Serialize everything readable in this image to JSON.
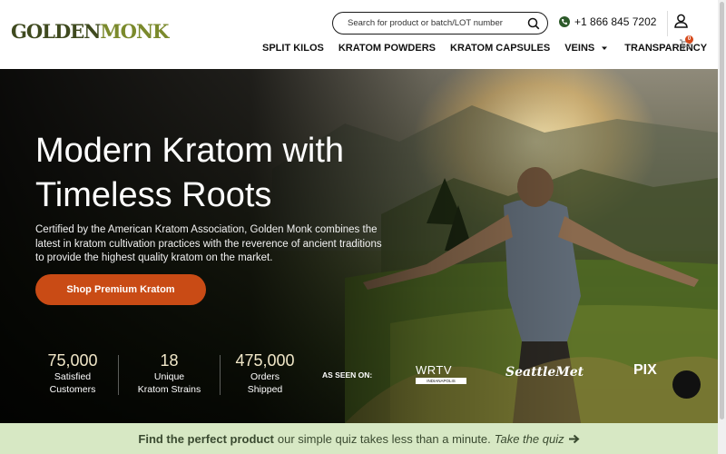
{
  "brand": {
    "logo_text_a": "GOLDEN",
    "logo_text_b": "MONK"
  },
  "search": {
    "placeholder": "Search for product or batch/LOT number"
  },
  "contact": {
    "phone": "+1 866 845 7202"
  },
  "nav": {
    "items": [
      {
        "label": "SPLIT KILOS"
      },
      {
        "label": "KRATOM POWDERS"
      },
      {
        "label": "KRATOM CAPSULES"
      },
      {
        "label": "VEINS"
      },
      {
        "label": "TRANSPARENCY"
      }
    ]
  },
  "cart": {
    "count": "0"
  },
  "hero": {
    "title": "Modern Kratom with Timeless Roots",
    "description": "Certified by the American Kratom Association, Golden Monk combines the latest in kratom cultivation practices with the reverence of ancient traditions to provide the highest quality kratom on the market.",
    "cta_label": "Shop Premium Kratom"
  },
  "stats": [
    {
      "value": "75,000",
      "label_1": "Satisfied",
      "label_2": "Customers"
    },
    {
      "value": "18",
      "label_1": "Unique",
      "label_2": "Kratom Strains"
    },
    {
      "value": "475,000",
      "label_1": "Orders",
      "label_2": "Shipped"
    }
  ],
  "as_seen_on": {
    "label": "AS SEEN ON:",
    "logos": [
      "WRTV",
      "INDIANAPOLIS",
      "SeattleMet",
      "PIX"
    ]
  },
  "quiz": {
    "bold": "Find the perfect product",
    "lead": "our simple quiz takes less than a minute.",
    "link": "Take the quiz"
  },
  "colors": {
    "cta": "#c94b15",
    "quiz_bg": "#d7e8c4",
    "logo_dark": "#3f4a1f",
    "logo_accent": "#7b8a2c",
    "phone_icon": "#2d5a2a"
  }
}
